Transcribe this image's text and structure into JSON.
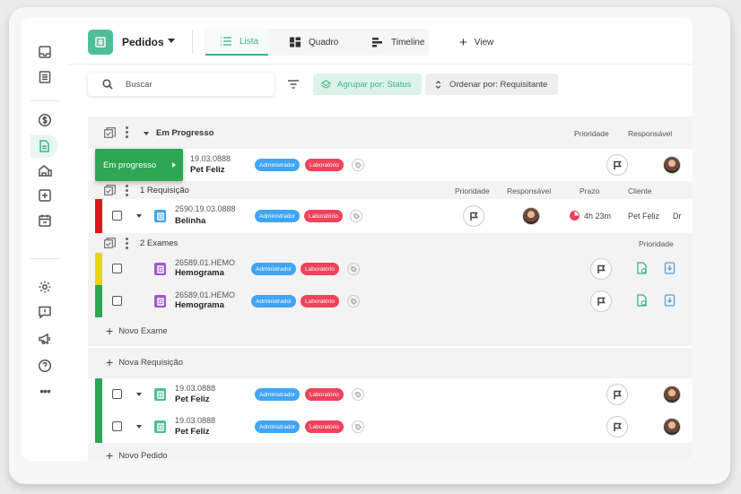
{
  "header": {
    "title": "Pedidos",
    "tabs": [
      {
        "label": "Lista",
        "icon": "list-icon",
        "active": true
      },
      {
        "label": "Quadro",
        "icon": "board-icon",
        "active": false
      },
      {
        "label": "Timeline",
        "icon": "timeline-icon",
        "active": false
      }
    ],
    "add_view": "View",
    "accent": "#3fb38a"
  },
  "toolbar": {
    "search_placeholder": "Buscar",
    "group_by": "Agrupar por: Status",
    "order_by": "Ordenar por: Requisitante"
  },
  "group": {
    "title": "Em Progresso",
    "col_priority": "Prioridade",
    "col_responsible": "Responsável",
    "drag_label": "Em progresso"
  },
  "pedido1": {
    "code": "19.03.0888",
    "name": "Pet Feliz",
    "tags": [
      "Administrador",
      "Laboratório"
    ]
  },
  "requisicoes": {
    "title": "1 Requisição",
    "cols": [
      "Prioridade",
      "Responsável",
      "Prazo",
      "Cliente",
      "Dr"
    ],
    "item": {
      "code": "2590.19.03.0888",
      "name": "Belinha",
      "tags": [
        "Administrador",
        "Laboratório"
      ],
      "prazo": "4h 23m",
      "cliente": "Pet Feliz",
      "status_color": "#e0161d"
    }
  },
  "exames": {
    "title": "2 Exames",
    "col_priority": "Prioridade",
    "items": [
      {
        "code": "26589.01.HEMO",
        "name": "Hemograma",
        "tags": [
          "Administrador",
          "Laboratório"
        ],
        "status_color": "#e8d31a"
      },
      {
        "code": "26589.01.HEMO",
        "name": "Hemograma",
        "tags": [
          "Administrador",
          "Laboratório"
        ],
        "status_color": "#2ea654"
      }
    ],
    "add_label": "Novo Exame"
  },
  "add_requisicao": "Nova Requisição",
  "pedidos": [
    {
      "code": "19.03.0888",
      "name": "Pet Feliz",
      "tags": [
        "Administrador",
        "Laboratório"
      ],
      "status_color": "#2ea654"
    },
    {
      "code": "19.03.0888",
      "name": "Pet Feliz",
      "tags": [
        "Administrador",
        "Laboratório"
      ],
      "status_color": "#2ea654"
    }
  ],
  "add_pedido": "Novo Pedido"
}
